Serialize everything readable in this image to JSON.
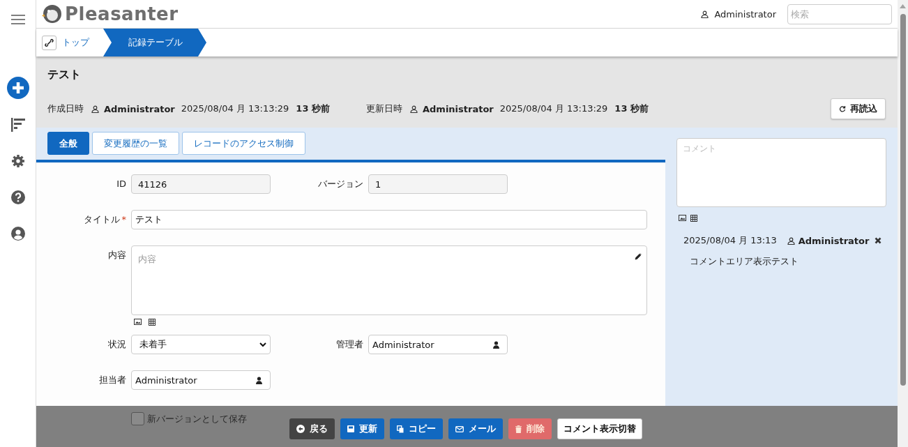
{
  "header": {
    "logo_text": "Pleasanter",
    "user": "Administrator",
    "search": {
      "placeholder": "検索"
    }
  },
  "breadcrumb": [
    {
      "label": "トップ",
      "selected": false
    },
    {
      "label": "記録テーブル",
      "selected": true
    }
  ],
  "record": {
    "title": "テスト",
    "created": {
      "label": "作成日時",
      "user": "Administrator",
      "datetime": "2025/08/04 月 13:13:29",
      "relative": "13 秒前"
    },
    "updated": {
      "label": "更新日時",
      "user": "Administrator",
      "datetime": "2025/08/04 月 13:13:29",
      "relative": "13 秒前"
    },
    "reload_button": "再読込"
  },
  "tabs": [
    {
      "label": "全般",
      "selected": true
    },
    {
      "label": "変更履歴の一覧",
      "selected": false
    },
    {
      "label": "レコードのアクセス制御",
      "selected": false
    }
  ],
  "form": {
    "rows": [
      [
        {
          "kind": "readonly",
          "label": "ID",
          "value": "41126"
        },
        {
          "kind": "readonly",
          "label": "バージョン",
          "value": "1"
        }
      ],
      [
        {
          "kind": "text",
          "label": "タイトル",
          "required_mark": "*",
          "value": "テスト"
        }
      ],
      [
        {
          "kind": "textarea",
          "label": "内容",
          "placeholder": "内容"
        }
      ],
      [
        {
          "kind": "select",
          "label": "状況",
          "value": "未着手"
        },
        {
          "kind": "user",
          "label": "管理者",
          "value": "Administrator"
        }
      ],
      [
        {
          "kind": "user",
          "label": "担当者",
          "value": "Administrator"
        }
      ]
    ]
  },
  "save_as_new_version": {
    "label": "新バージョンとして保存",
    "checked": false
  },
  "comment": {
    "placeholder": "コメント",
    "entries": [
      {
        "datetime": "2025/08/04 月 13:13",
        "user": "Administrator",
        "text": "コメントエリア表示テスト"
      }
    ]
  },
  "buttons": [
    {
      "kind": "back",
      "label": "戻る"
    },
    {
      "kind": "update",
      "label": "更新"
    },
    {
      "kind": "copy",
      "label": "コピー"
    },
    {
      "kind": "mail",
      "label": "メール"
    },
    {
      "kind": "delete",
      "label": "削除"
    },
    {
      "kind": "toggle",
      "label": "コメント表示切替"
    }
  ]
}
